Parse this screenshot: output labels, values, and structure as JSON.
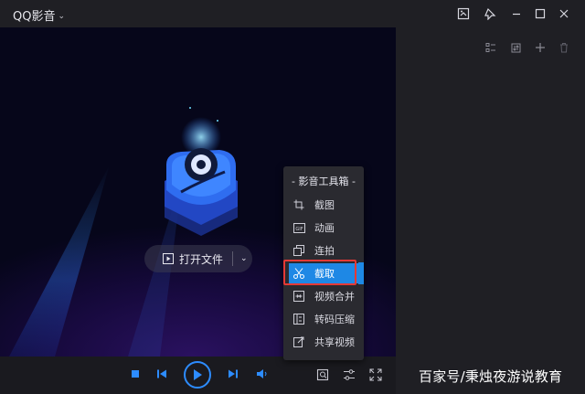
{
  "app": {
    "title": "QQ影音"
  },
  "window": {
    "icons": [
      "screenshot-window-icon",
      "pin-icon",
      "minimize-icon",
      "maximize-icon",
      "close-icon"
    ]
  },
  "video": {
    "open_file_label": "打开文件"
  },
  "toolbox": {
    "title": "- 影音工具箱 -",
    "items": [
      {
        "label": "截图",
        "icon": "crop-icon"
      },
      {
        "label": "动画",
        "icon": "gif-icon"
      },
      {
        "label": "连拍",
        "icon": "burst-icon"
      },
      {
        "label": "截取",
        "icon": "scissors-icon"
      },
      {
        "label": "视频合并",
        "icon": "merge-icon"
      },
      {
        "label": "转码压缩",
        "icon": "compress-icon"
      },
      {
        "label": "共享视频",
        "icon": "share-icon"
      }
    ],
    "selected": "截取"
  },
  "colors": {
    "accent": "#1e88e5",
    "highlight": "#e53935",
    "background": "#1d1d22"
  },
  "watermark": "百家号/秉烛夜游说教育"
}
